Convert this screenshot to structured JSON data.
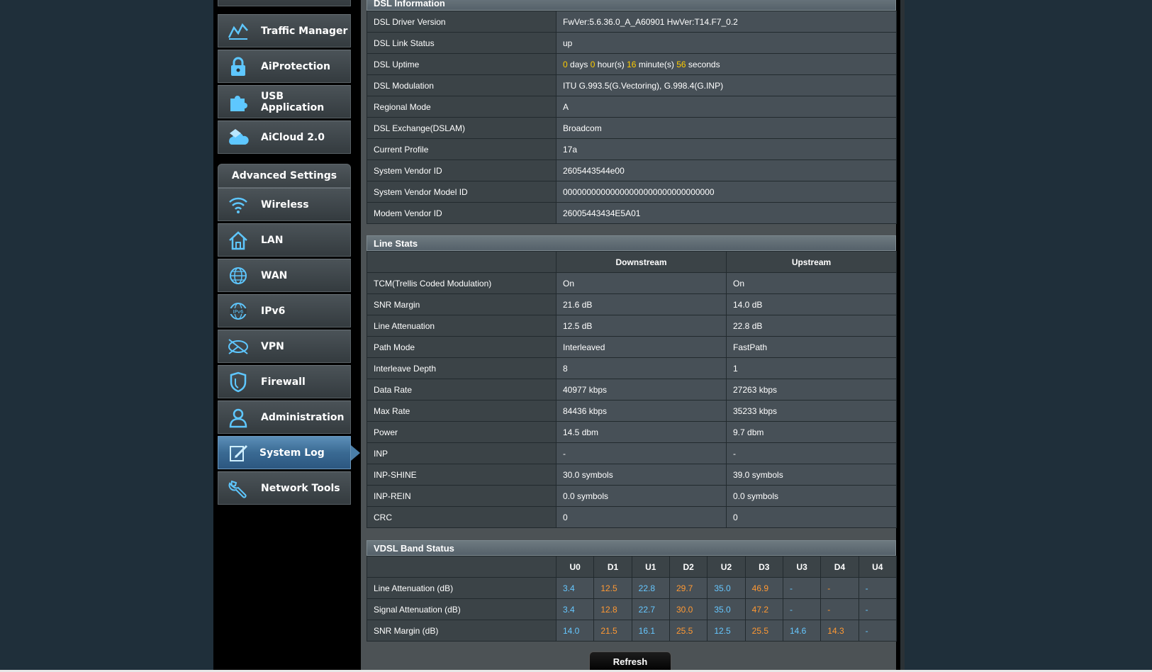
{
  "sidebar": {
    "top_items": [
      {
        "label": "Traffic Manager",
        "icon": "traffic-manager-icon"
      },
      {
        "label": "AiProtection",
        "icon": "lock-icon"
      },
      {
        "label": "USB Application",
        "icon": "puzzle-icon"
      },
      {
        "label": "AiCloud 2.0",
        "icon": "cloud-icon"
      }
    ],
    "section_title": "Advanced Settings",
    "advanced_items": [
      {
        "label": "Wireless",
        "icon": "wifi-icon"
      },
      {
        "label": "LAN",
        "icon": "home-icon"
      },
      {
        "label": "WAN",
        "icon": "globe-icon"
      },
      {
        "label": "IPv6",
        "icon": "ipv6-globe-icon"
      },
      {
        "label": "VPN",
        "icon": "vpn-icon"
      },
      {
        "label": "Firewall",
        "icon": "shield-icon"
      },
      {
        "label": "Administration",
        "icon": "user-icon"
      },
      {
        "label": "System Log",
        "icon": "edit-document-icon",
        "active": true
      },
      {
        "label": "Network Tools",
        "icon": "wrench-icon"
      }
    ]
  },
  "dsl_info": {
    "title": "DSL Information",
    "rows": [
      {
        "label": "DSL Driver Version",
        "value": "FwVer:5.6.36.0_A_A60901 HwVer:T14.F7_0.2"
      },
      {
        "label": "DSL Link Status",
        "value": "up"
      },
      {
        "label": "DSL Uptime",
        "value": ""
      },
      {
        "label": "DSL Modulation",
        "value": "ITU G.993.5(G.Vectoring), G.998.4(G.INP)"
      },
      {
        "label": "Regional Mode",
        "value": "A"
      },
      {
        "label": "DSL Exchange(DSLAM)",
        "value": "Broadcom"
      },
      {
        "label": "Current Profile",
        "value": "17a"
      },
      {
        "label": "System Vendor ID",
        "value": "2605443544e00"
      },
      {
        "label": "System Vendor Model ID",
        "value": "00000000000000000000000000000000"
      },
      {
        "label": "Modem Vendor ID",
        "value": "26005443434E5A01"
      }
    ],
    "uptime": {
      "days": "0",
      "days_label": "days",
      "hours": "0",
      "hours_label": "hour(s)",
      "minutes": "16",
      "minutes_label": "minute(s)",
      "seconds": "56",
      "seconds_label": "seconds"
    }
  },
  "line_stats": {
    "title": "Line Stats",
    "headers": [
      "Downstream",
      "Upstream"
    ],
    "rows": [
      {
        "label": "TCM(Trellis Coded Modulation)",
        "down": "On",
        "up": "On"
      },
      {
        "label": "SNR Margin",
        "down": "21.6 dB",
        "up": "14.0 dB"
      },
      {
        "label": "Line Attenuation",
        "down": "12.5 dB",
        "up": "22.8 dB"
      },
      {
        "label": "Path Mode",
        "down": "Interleaved",
        "up": "FastPath"
      },
      {
        "label": "Interleave Depth",
        "down": "8",
        "up": "1"
      },
      {
        "label": "Data Rate",
        "down": "40977 kbps",
        "up": "27263 kbps"
      },
      {
        "label": "Max Rate",
        "down": "84436 kbps",
        "up": "35233 kbps"
      },
      {
        "label": "Power",
        "down": "14.5 dbm",
        "up": "9.7 dbm"
      },
      {
        "label": "INP",
        "down": "-",
        "up": "-"
      },
      {
        "label": "INP-SHINE",
        "down": "30.0 symbols",
        "up": "39.0 symbols"
      },
      {
        "label": "INP-REIN",
        "down": "0.0 symbols",
        "up": "0.0 symbols"
      },
      {
        "label": "CRC",
        "down": "0",
        "up": "0"
      }
    ]
  },
  "vdsl_band": {
    "title": "VDSL Band Status",
    "bands": [
      "U0",
      "D1",
      "U1",
      "D2",
      "U2",
      "D3",
      "U3",
      "D4",
      "U4"
    ],
    "rows": [
      {
        "label": "Line Attenuation (dB)",
        "values": [
          "3.4",
          "12.5",
          "22.8",
          "29.7",
          "35.0",
          "46.9",
          "-",
          "-",
          "-"
        ]
      },
      {
        "label": "Signal Attenuation (dB)",
        "values": [
          "3.4",
          "12.8",
          "22.7",
          "30.0",
          "35.0",
          "47.2",
          "-",
          "-",
          "-"
        ]
      },
      {
        "label": "SNR Margin (dB)",
        "values": [
          "14.0",
          "21.5",
          "16.1",
          "25.5",
          "12.5",
          "25.5",
          "14.6",
          "14.3",
          "-"
        ]
      }
    ],
    "upstream_color": "#66c7ff",
    "downstream_color": "#ff9933"
  },
  "refresh_label": "Refresh"
}
